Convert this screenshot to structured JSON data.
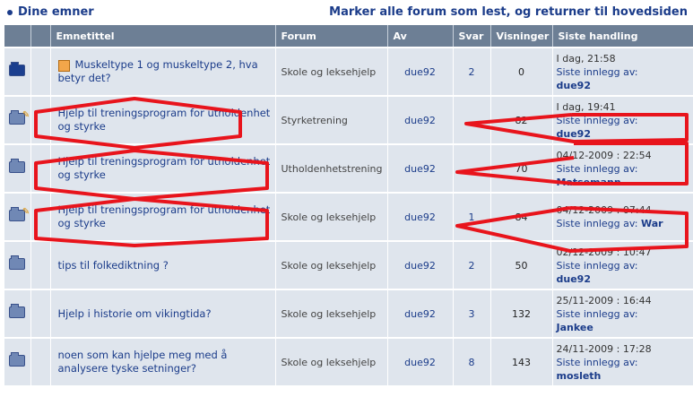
{
  "header": {
    "title": "Dine emner",
    "mark_all_link": "Marker alle forum som lest, og returner til hovedsiden"
  },
  "columns": [
    "Emnetittel",
    "Forum",
    "Av",
    "Svar",
    "Visninger",
    "Siste handling"
  ],
  "rows": [
    {
      "title": "Muskeltype 1 og muskeltype 2, hva betyr det?",
      "forum": "Skole og leksehjelp",
      "author": "due92",
      "replies": "2",
      "views": "0",
      "last_date": "I dag, 21:58",
      "last_label": "Siste innlegg av:",
      "last_user": "due92"
    },
    {
      "title": "Hjelp til treningsprogram for utholdenhet og styrke",
      "forum": "Styrketrening",
      "author": "due92",
      "replies": "",
      "views": "82",
      "last_date": "I dag, 19:41",
      "last_label": "Siste innlegg av:",
      "last_user": "due92"
    },
    {
      "title": "Hjelp til treningsprogram for utholdenhet og styrke",
      "forum": "Utholdenhetstrening",
      "author": "due92",
      "replies": "",
      "views": "70",
      "last_date": "04/12-2009 : 22:54",
      "last_label": "Siste innlegg av:",
      "last_user": "Matsemann"
    },
    {
      "title": "Hjelp til treningsprogram for utholdenhet og styrke",
      "forum": "Skole og leksehjelp",
      "author": "due92",
      "replies": "1",
      "views": "84",
      "last_date": "04/12-2009 : 07:44",
      "last_label": "Siste innlegg av:",
      "last_user": "War"
    },
    {
      "title": "tips til folkediktning ?",
      "forum": "Skole og leksehjelp",
      "author": "due92",
      "replies": "2",
      "views": "50",
      "last_date": "02/12-2009 : 10:47",
      "last_label": "Siste innlegg av:",
      "last_user": "due92"
    },
    {
      "title": "Hjelp i historie om vikingtida?",
      "forum": "Skole og leksehjelp",
      "author": "due92",
      "replies": "3",
      "views": "132",
      "last_date": "25/11-2009 : 16:44",
      "last_label": "Siste innlegg av:",
      "last_user": "Jankee"
    },
    {
      "title": "noen som kan hjelpe meg med å analysere tyske setninger?",
      "forum": "Skole og leksehjelp",
      "author": "due92",
      "replies": "8",
      "views": "143",
      "last_date": "24/11-2009 : 17:28",
      "last_label": "Siste innlegg av:",
      "last_user": "mosleth"
    }
  ],
  "annotation_color": "#e8141c"
}
